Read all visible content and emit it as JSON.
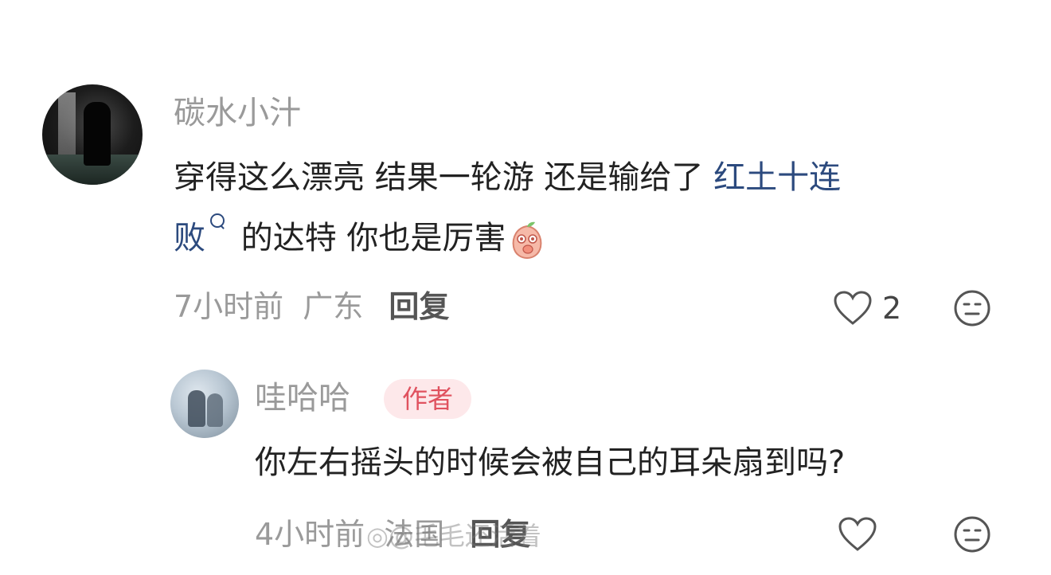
{
  "comments": [
    {
      "username": "碳水小汁",
      "text_line1_plain": "穿得这么漂亮 结果一轮游 还是输给了 ",
      "text_line1_link": "红土十连",
      "text_line2_link": "败",
      "text_line2_plain": " 的达特 你也是厉害",
      "emoji": "peach-sticker-icon",
      "time": "7小时前",
      "location": "广东",
      "reply_label": "回复",
      "like_count": "2"
    },
    {
      "username": "哇哈哈",
      "badge": "作者",
      "text": "你左右摇头的时候会被自己的耳朵扇到吗?",
      "time": "4小时前",
      "location": "法国",
      "reply_label": "回复"
    }
  ],
  "watermark": "@毛毛还活着",
  "colors": {
    "link": "#2c4a7e",
    "badge_bg": "#fde8ea",
    "badge_text": "#e0525f",
    "muted": "#9a9a9a"
  }
}
